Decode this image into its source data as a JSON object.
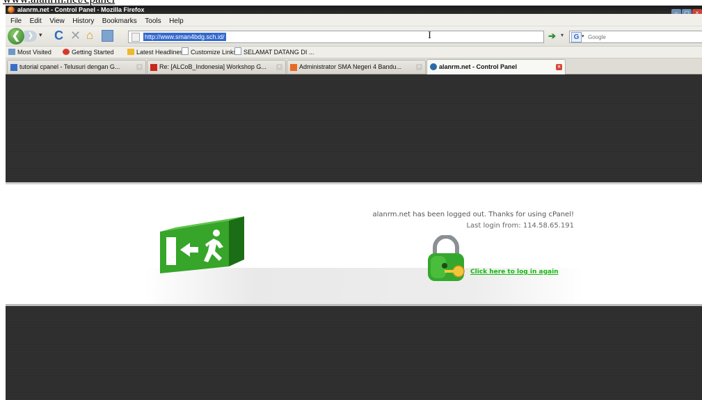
{
  "caption": "www.alanrm.net/cpanel",
  "window": {
    "title": "alanrm.net - Control Panel - Mozilla Firefox",
    "controls": {
      "minimize": "–",
      "maximize": "▢",
      "close": "×"
    }
  },
  "menu": [
    "File",
    "Edit",
    "View",
    "History",
    "Bookmarks",
    "Tools",
    "Help"
  ],
  "nav": {
    "url": "http://www.sman4bdg.sch.id/",
    "search_placeholder": "Google",
    "search_engine_glyph": "G",
    "icons": [
      "back-arrow",
      "forward-arrow",
      "reload",
      "stop",
      "home",
      "bookmark-page",
      "go-arrow"
    ]
  },
  "bookmarks": [
    "Most Visited",
    "Getting Started",
    "Latest Headlines",
    "Customize Links",
    "SELAMAT DATANG DI ..."
  ],
  "tabs": [
    {
      "label": "tutorial cpanel - Telusuri dengan G...",
      "icon": "google-icon",
      "color": "#3b6fc7",
      "active": false
    },
    {
      "label": "Re: [ALCoB_Indonesia] Workshop G...",
      "icon": "yahoo-icon",
      "color": "#c9281c",
      "active": false
    },
    {
      "label": "Administrator SMA Negeri 4 Bandu...",
      "icon": "joomla-icon",
      "color": "#e86b25",
      "active": false
    },
    {
      "label": "alanrm.net - Control Panel",
      "icon": "cpanel-icon",
      "color": "#2a6aa8",
      "active": true
    }
  ],
  "page": {
    "logout_message": "alanrm.net has been logged out. Thanks for using cPanel!",
    "last_login": "Last login from: 114.58.65.191",
    "login_link": "Click here to log in again",
    "colors": {
      "background_dark": "#2e2e2e",
      "link_green": "#15b80f",
      "sign_green": "#3aa52c"
    }
  }
}
